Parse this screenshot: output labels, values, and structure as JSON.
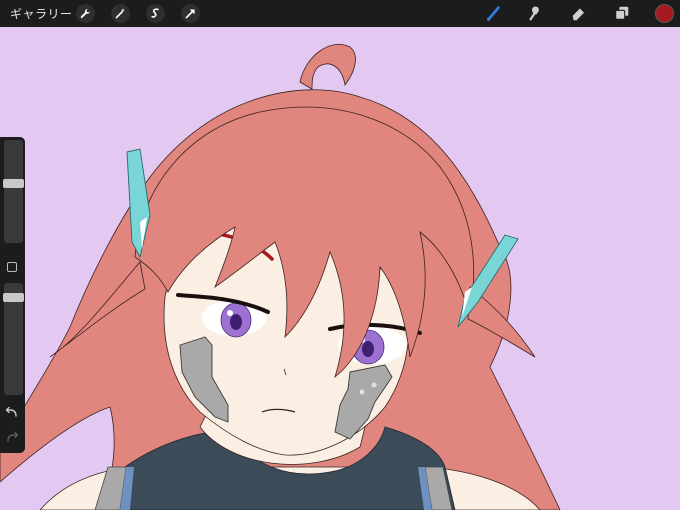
{
  "topbar": {
    "gallery_label": "ギャラリー",
    "tools_left": [
      "wrench-icon",
      "magic-wand-icon",
      "selection-icon",
      "transform-arrow-icon"
    ],
    "tools_right": [
      "brush-icon",
      "smudge-icon",
      "eraser-icon",
      "layers-icon"
    ],
    "active_tool_color": "#2f7fd8",
    "current_color": "#a6191f"
  },
  "sidebar": {
    "brush_size": 0.58,
    "opacity": 0.1,
    "buttons": [
      "modify-square-icon",
      "undo-icon",
      "redo-icon"
    ]
  },
  "canvas": {
    "background_color": "#e3c9f1",
    "hair_color": "#e1867e",
    "skin_color": "#fbefe3",
    "eye_color": "#9b72cf",
    "clip_color": "#79d5d6",
    "mask_color": "#a9a9a9",
    "top_color": "#3b4b58"
  }
}
